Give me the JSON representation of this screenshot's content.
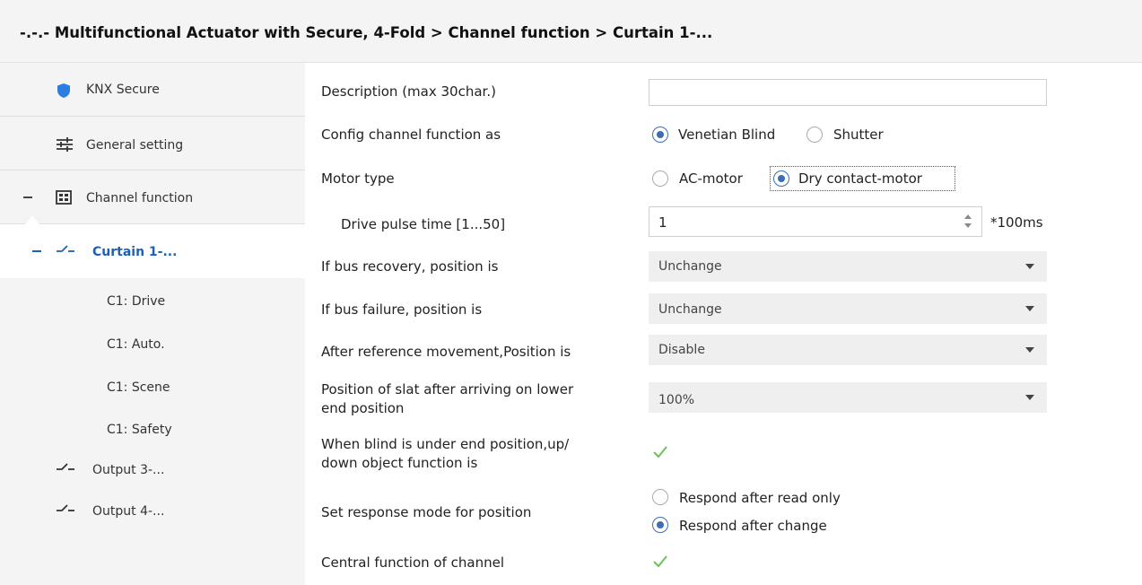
{
  "window": {
    "title": "-.-.- Multifunctional Actuator with Secure, 4-Fold > Channel function > Curtain 1-..."
  },
  "sidebar": {
    "knx_secure": "KNX Secure",
    "general_setting": "General setting",
    "channel_function": "Channel function",
    "curtain": "Curtain 1-...",
    "sub_items": [
      "C1: Drive",
      "C1: Auto.",
      "C1: Scene",
      "C1: Safety"
    ],
    "output3": "Output 3-...",
    "output4": "Output 4-..."
  },
  "form": {
    "description": {
      "label": "Description (max 30char.)",
      "value": ""
    },
    "config_channel": {
      "label": "Config channel function as",
      "options": [
        "Venetian Blind",
        "Shutter"
      ],
      "selected": "Venetian Blind"
    },
    "motor_type": {
      "label": "Motor type",
      "options": [
        "AC-motor",
        "Dry contact-motor"
      ],
      "selected": "Dry contact-motor"
    },
    "drive_pulse": {
      "label": "Drive pulse time [1...50]",
      "value": "1",
      "unit": "*100ms"
    },
    "bus_recovery": {
      "label": "If bus recovery, position is",
      "value": "Unchange"
    },
    "bus_failure": {
      "label": "If bus failure, position is",
      "value": "Unchange"
    },
    "after_reference": {
      "label": "After reference movement,Position is",
      "value": "Disable"
    },
    "slat_position": {
      "label_line1": "Position of slat after arriving on lower",
      "label_line2": "end position",
      "value": "100%"
    },
    "blind_under_end": {
      "label_line1": "When blind is under end position,up/",
      "label_line2": "down object function is",
      "checked": true
    },
    "response_mode": {
      "label": "Set response mode for position",
      "options": [
        "Respond after read only",
        "Respond after change"
      ],
      "selected": "Respond after change"
    },
    "central_function": {
      "label": "Central function of channel",
      "checked": true
    }
  },
  "colors": {
    "accent": "#1c61b4",
    "radio": "#3d6eb5",
    "check": "#6fbf5e",
    "shield": "#2b7de0"
  }
}
